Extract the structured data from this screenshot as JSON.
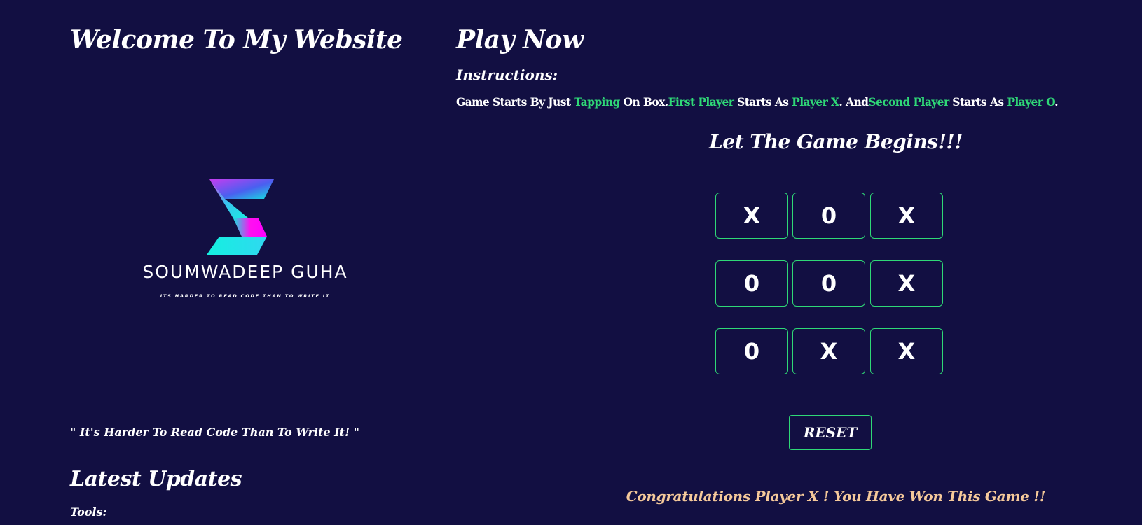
{
  "colors": {
    "background": "#120f42",
    "accent_green": "#2fd877",
    "win_text": "#f5c99a",
    "text": "#ffffff"
  },
  "left": {
    "title": "Welcome To My Website",
    "logo": {
      "name": "SOUMWADEEP  GUHA",
      "tagline": "ITS HARDER TO READ CODE THAN TO WRITE IT",
      "icon": "s-logo-icon"
    },
    "quote": "\" It's Harder To Read Code Than To Write It! \"",
    "updates_title": "Latest Updates",
    "tools_label": "Tools:"
  },
  "game": {
    "title": "Play Now",
    "instructions_label": "Instructions:",
    "instructions": {
      "p1": "Game Starts By Just ",
      "h1": "Tapping",
      "p2": " On Box.",
      "h2": "First Player",
      "p3": " Starts As ",
      "h3": "Player X",
      "p4": ". And",
      "h4": "Second Player",
      "p5": " Starts As ",
      "h5": "Player O",
      "p6": "."
    },
    "heading": "Let The Game Begins!!!",
    "board": [
      [
        "X",
        "0",
        "X"
      ],
      [
        "0",
        "0",
        "X"
      ],
      [
        "0",
        "X",
        "X"
      ]
    ],
    "reset_label": "RESET",
    "win_message": "Congratulations Player X ! You Have Won This Game !!"
  }
}
